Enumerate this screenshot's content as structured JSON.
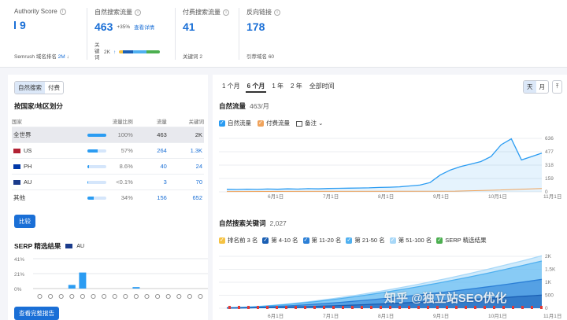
{
  "metrics": {
    "authority": {
      "label": "Authority Score",
      "value": "9",
      "sub_label": "Semrush 域名排名",
      "sub_value": "2M",
      "trend": "↓"
    },
    "organic": {
      "label": "自然搜索流量",
      "value": "463",
      "change": "+35%",
      "link": "查看详情",
      "kw_label": "关键词",
      "kw_value": "2K",
      "kw_arrow": "↑"
    },
    "paid": {
      "label": "付费搜索流量",
      "value": "41",
      "sub_label": "关键词",
      "sub_value": "2"
    },
    "backlinks": {
      "label": "反向链接",
      "value": "178",
      "sub_label": "引荐域名",
      "sub_value": "60"
    }
  },
  "left": {
    "tabs": [
      "自然搜索",
      "付费"
    ],
    "region_title": "按国家/地区划分",
    "columns": [
      "国家",
      "流量比例",
      "流量",
      "关键词"
    ],
    "rows": [
      {
        "country": "全世界",
        "share": "100%",
        "share_num": 100,
        "traffic": "463",
        "keywords": "2K",
        "flag": ""
      },
      {
        "country": "US",
        "share": "57%",
        "share_num": 57,
        "traffic": "264",
        "keywords": "1.3K",
        "flag": "us"
      },
      {
        "country": "PH",
        "share": "8.6%",
        "share_num": 8.6,
        "traffic": "40",
        "keywords": "24",
        "flag": "ph"
      },
      {
        "country": "AU",
        "share": "<0.1%",
        "share_num": 0.5,
        "traffic": "3",
        "keywords": "70",
        "flag": "au"
      },
      {
        "country": "其他",
        "share": "34%",
        "share_num": 34,
        "traffic": "156",
        "keywords": "652",
        "flag": ""
      }
    ],
    "compare_btn": "比较",
    "serp_title": "SERP 精选结果",
    "serp_country": "AU",
    "serp_ticks": [
      "41%",
      "21%",
      "0%"
    ],
    "serp_bars": [
      0,
      0,
      0,
      0.05,
      0.22,
      0,
      0,
      0,
      0,
      0.02,
      0,
      0,
      0,
      0,
      0,
      0
    ],
    "serp_btn": "查看完整报告"
  },
  "periods": [
    "1 个月",
    "6 个月",
    "1 年",
    "2 年",
    "全部时间"
  ],
  "view_toggle": [
    "天",
    "月"
  ],
  "traffic_chart": {
    "title": "自然流量",
    "title_value": "463/月",
    "legend": [
      "自然流量",
      "付费流量",
      "备注"
    ],
    "colors": {
      "organic": "#2b9cf2",
      "paid": "#f0a35b"
    },
    "yticks": [
      "636",
      "477",
      "318",
      "159",
      "0"
    ],
    "xticks": [
      "6月1日",
      "7月1日",
      "8月1日",
      "9月1日",
      "10月1日",
      "11月1日"
    ]
  },
  "kw_chart": {
    "title": "自然搜索关键词",
    "title_value": "2,027",
    "legend": [
      {
        "label": "排名前 3 名",
        "color": "#f5c242"
      },
      {
        "label": "第 4-10 名",
        "color": "#1a5fb4"
      },
      {
        "label": "第 11-20 名",
        "color": "#2b7fd6"
      },
      {
        "label": "第 21-50 名",
        "color": "#4fb0f0"
      },
      {
        "label": "第 51-100 名",
        "color": "#a8d8f8"
      },
      {
        "label": "SERP 精选结果",
        "color": "#4caf50"
      }
    ],
    "yticks": [
      "2K",
      "1.5K",
      "1K",
      "500",
      "0"
    ],
    "xticks": [
      "6月1日",
      "7月1日",
      "8月1日",
      "9月1日",
      "10月1日",
      "11月1日"
    ]
  },
  "watermark": "知乎 @独立站SEO优化"
}
